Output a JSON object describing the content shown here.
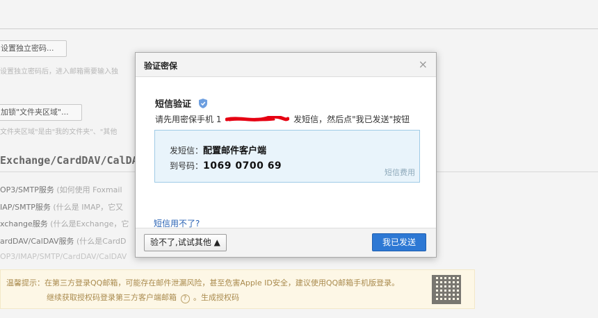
{
  "background": {
    "set_password_button": "设置独立密码...",
    "set_password_hint": "设置独立密码后，进入邮箱需要输入独",
    "lock_folder_button": "加锁\"文件夹区域\"...",
    "lock_folder_hint": "文件夹区域\"是由\"我的文件夹\"、\"其他",
    "section_title": "Exchange/CardDAV/CalDA",
    "service_rows": [
      {
        "main": "OP3/SMTP服务",
        "sub": " (如何使用 Foxmail"
      },
      {
        "main": "IAP/SMTP服务",
        "sub": " (什么是 IMAP，它又"
      },
      {
        "main": "xchange服务",
        "sub": " (什么是Exchange，它"
      },
      {
        "main": "ardDAV/CalDAV服务",
        "sub": " (什么是CardD"
      },
      {
        "main": "OP3/IMAP/SMTP/CardDAV/CalDAV",
        "sub": ""
      }
    ],
    "notice": {
      "line1": "温馨提示：在第三方登录QQ邮箱，可能存在邮件泄漏风险，甚至危害Apple ID安全，建议使用QQ邮箱手机版登录。",
      "line2_prefix": "继续获取授权码登录第三方客户端邮箱",
      "help_symbol": "?",
      "line2_suffix": "。生成授权码"
    }
  },
  "dialog": {
    "title": "验证密保",
    "close_symbol": "×",
    "sms_title": "短信验证",
    "instruction_prefix": "请先用密保手机 1",
    "instruction_suffix": " 发短信，然后点\"我已发送\"按钮",
    "send_label": "发短信：",
    "send_content": "配置邮件客户端",
    "to_label": "到号码：",
    "to_number": "1069 0700 69",
    "fee_label": "短信费用",
    "cant_use_link": "短信用不了?",
    "try_other_button": "验不了,试试其他 ▲",
    "sent_button": "我已发送"
  },
  "colors": {
    "primary": "#2d78d4",
    "link": "#2a63b5",
    "info_bg": "#e9f4fb",
    "info_border": "#9fcbe6",
    "redact": "#e60012"
  }
}
